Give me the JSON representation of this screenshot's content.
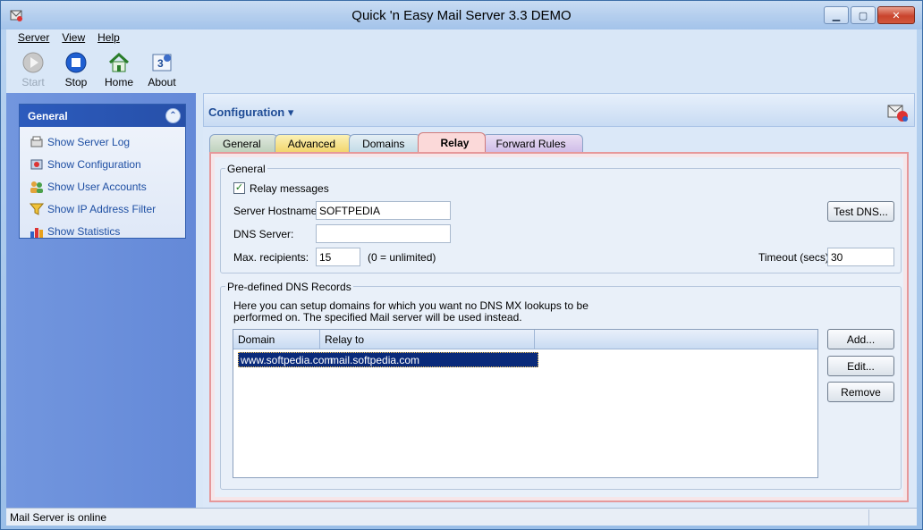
{
  "window": {
    "title": "Quick 'n Easy Mail Server 3.3 DEMO"
  },
  "menu": {
    "items": [
      "Server",
      "View",
      "Help"
    ]
  },
  "toolbar": {
    "start": "Start",
    "stop": "Stop",
    "home": "Home",
    "about": "About"
  },
  "nav": {
    "header": "General",
    "items": [
      "Show Server Log",
      "Show Configuration",
      "Show User Accounts",
      "Show IP Address Filter",
      "Show Statistics"
    ]
  },
  "config": {
    "title": "Configuration",
    "tabs": [
      "General",
      "Advanced",
      "Domains",
      "Relay",
      "Forward Rules"
    ],
    "active_tab": "Relay"
  },
  "relay": {
    "group_general": "General",
    "relay_messages_label": "Relay messages",
    "relay_messages_checked": true,
    "server_hostname_label": "Server Hostname:",
    "server_hostname_value": "SOFTPEDIA",
    "dns_server_label": "DNS Server:",
    "dns_server_value": "",
    "max_recipients_label": "Max. recipients:",
    "max_recipients_value": "15",
    "max_recipients_hint": "(0 = unlimited)",
    "timeout_label": "Timeout (secs):",
    "timeout_value": "30",
    "test_dns_button": "Test DNS...",
    "group_dns": "Pre-defined DNS Records",
    "dns_description_line1": "Here you can setup domains for which you want no DNS MX lookups to be",
    "dns_description_line2": "performed on. The specified Mail server will be used instead.",
    "columns": [
      "Domain",
      "Relay to"
    ],
    "rows": [
      {
        "domain": "www.softpedia.com",
        "relay_to": "mail.softpedia.com"
      }
    ],
    "add_button": "Add...",
    "edit_button": "Edit...",
    "remove_button": "Remove"
  },
  "status": {
    "text": "Mail Server is online"
  }
}
